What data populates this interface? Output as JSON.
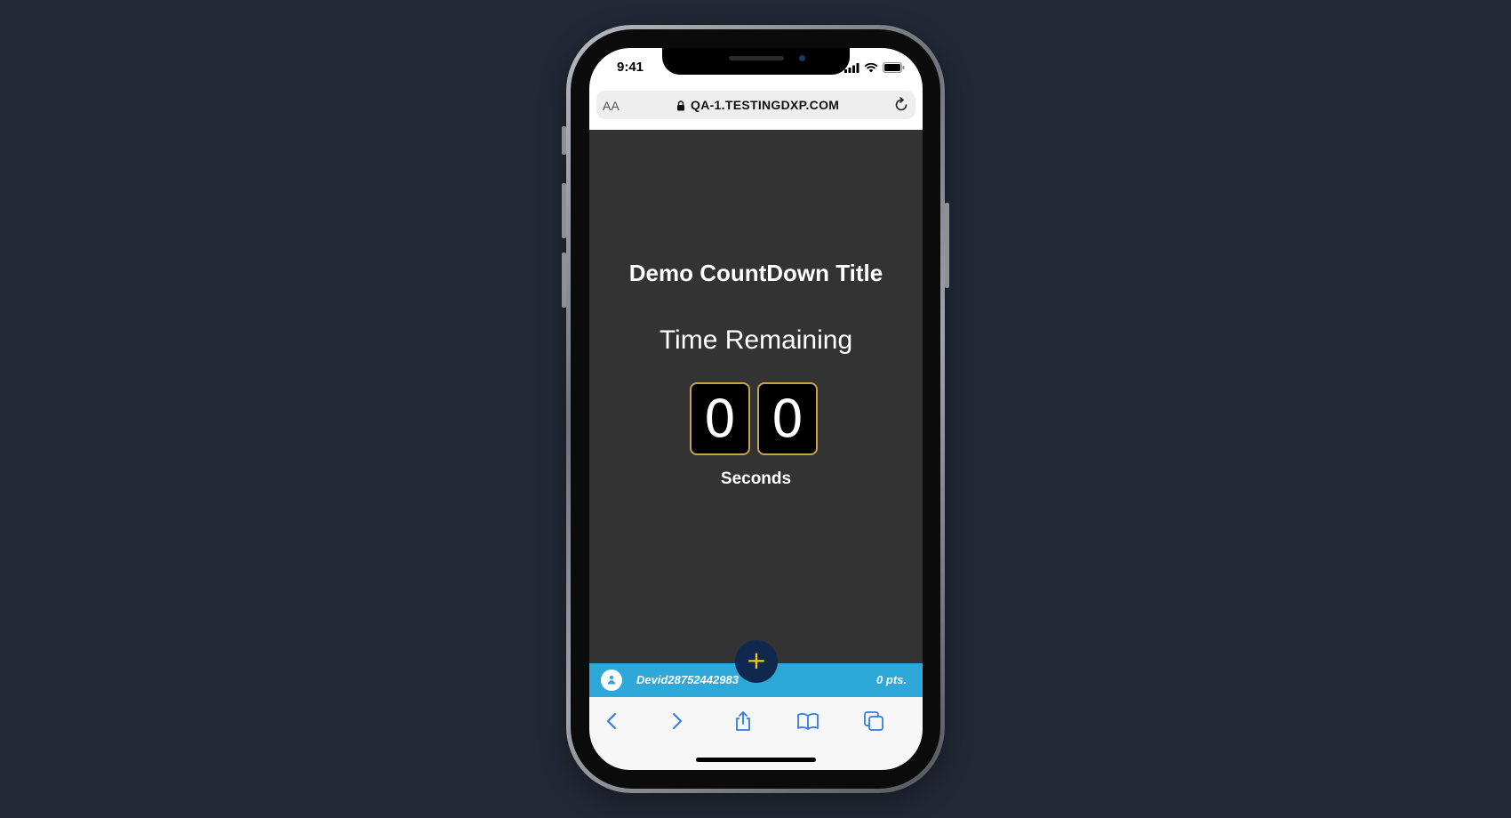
{
  "status_bar": {
    "time": "9:41",
    "icons": [
      "signal-icon",
      "wifi-icon",
      "battery-icon"
    ]
  },
  "browser": {
    "text_size_label": "AA",
    "url": "QA-1.TESTINGDXP.COM",
    "icons": [
      "lock-icon",
      "reload-icon"
    ]
  },
  "countdown": {
    "title": "Demo CountDown Title",
    "subtitle": "Time Remaining",
    "digits": [
      "0",
      "0"
    ],
    "unit_label": "Seconds",
    "digit_border_color": "#c9a24d"
  },
  "user_bar": {
    "username": "Devid28752442983",
    "points": "0 pts.",
    "background_color": "#2ea7d9"
  },
  "fab": {
    "label": "+",
    "color": "#f2c230"
  },
  "toolbar": {
    "items": [
      "back-icon",
      "forward-icon",
      "share-icon",
      "bookmarks-icon",
      "tabs-icon"
    ]
  }
}
